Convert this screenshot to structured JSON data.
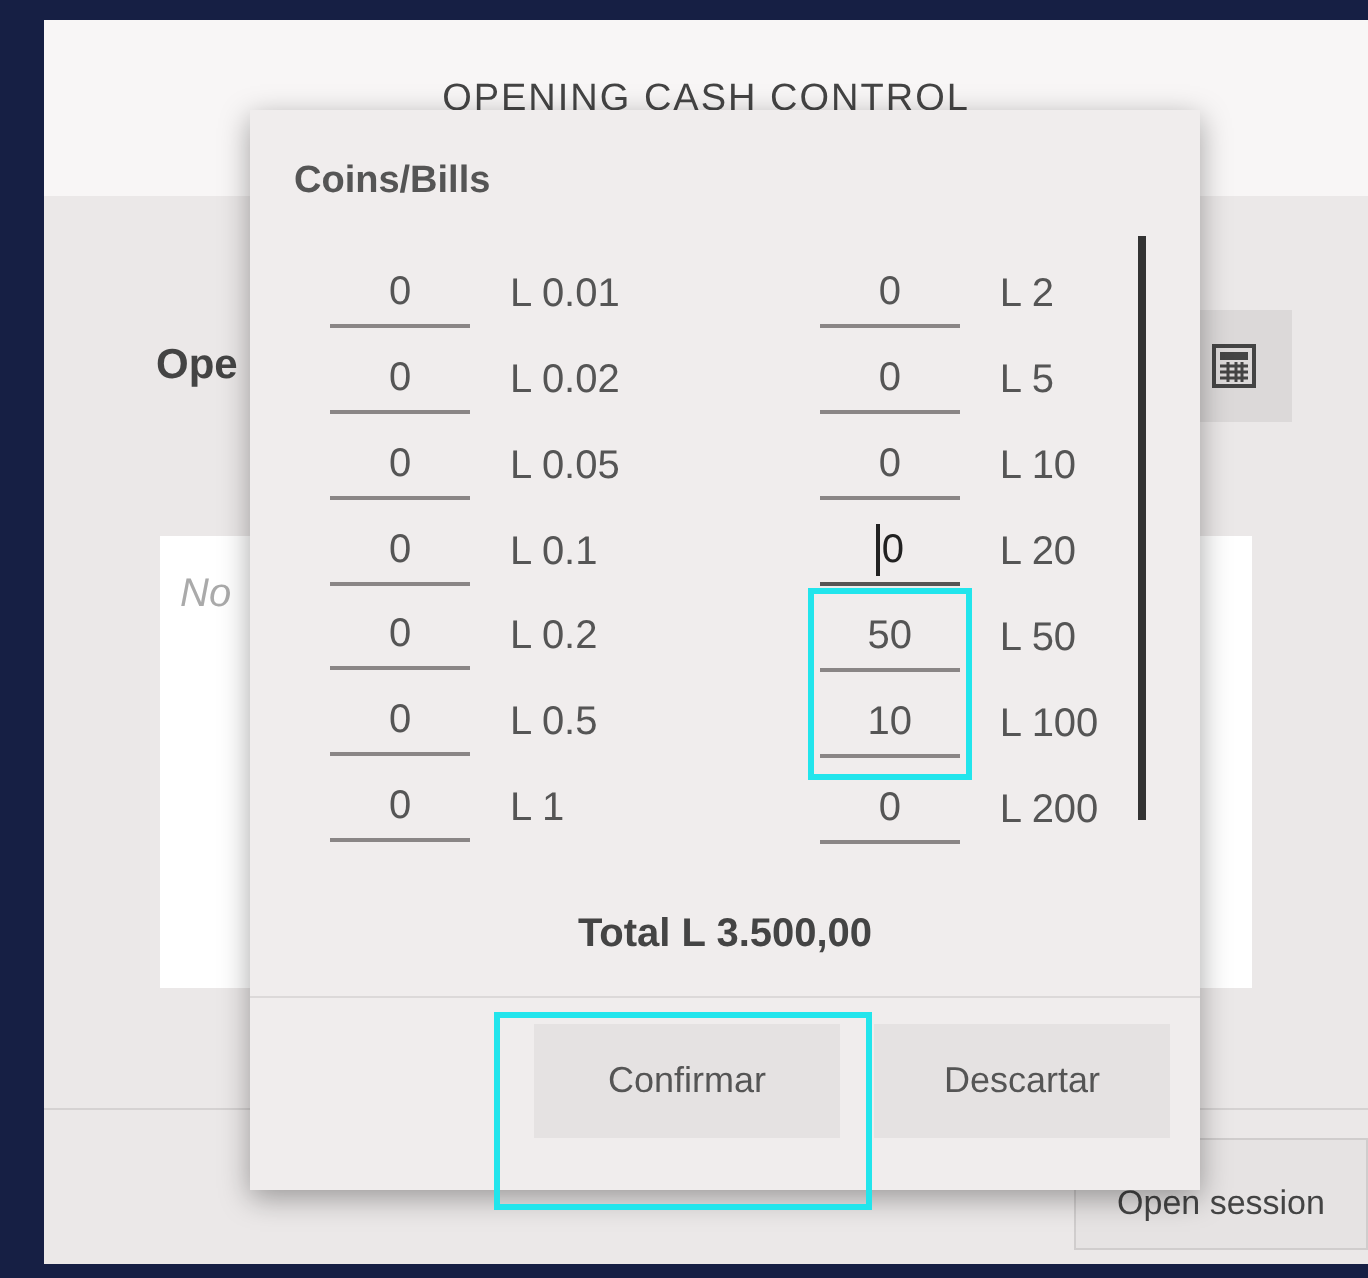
{
  "dialog": {
    "title": "OPENING CASH CONTROL",
    "heading": "Ope",
    "notes": {
      "placeholder": "No"
    },
    "open_button": "Open session"
  },
  "popup": {
    "title": "Coins/Bills",
    "left": [
      {
        "value": "0",
        "label": "L 0.01",
        "focused": false
      },
      {
        "value": "0",
        "label": "L 0.02",
        "focused": false
      },
      {
        "value": "0",
        "label": "L 0.05",
        "focused": false
      },
      {
        "value": "0",
        "label": "L 0.1",
        "focused": false
      },
      {
        "value": "0",
        "label": "L 0.2",
        "focused": false
      },
      {
        "value": "0",
        "label": "L 0.5",
        "focused": false
      },
      {
        "value": "0",
        "label": "L 1",
        "focused": false
      }
    ],
    "right": [
      {
        "value": "0",
        "label": "L 2",
        "focused": false,
        "highlighted": false
      },
      {
        "value": "0",
        "label": "L 5",
        "focused": false,
        "highlighted": false
      },
      {
        "value": "0",
        "label": "L 10",
        "focused": false,
        "highlighted": false
      },
      {
        "value": "0",
        "label": "L 20",
        "focused": true,
        "highlighted": false
      },
      {
        "value": "50",
        "label": "L 50",
        "focused": false,
        "highlighted": true
      },
      {
        "value": "10",
        "label": "L 100",
        "focused": false,
        "highlighted": true
      },
      {
        "value": "0",
        "label": "L 200",
        "focused": false,
        "highlighted": false
      }
    ],
    "total": "Total L 3.500,00",
    "buttons": [
      {
        "label": "Confirmar",
        "highlighted": true
      },
      {
        "label": "Descartar",
        "highlighted": false
      }
    ]
  }
}
